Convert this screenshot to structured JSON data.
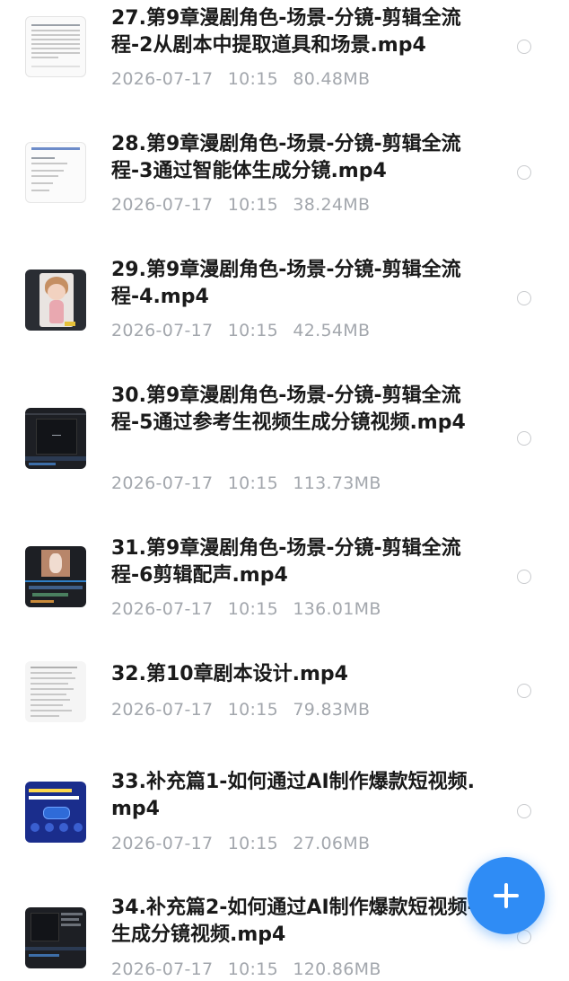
{
  "files": [
    {
      "name": "27.第9章漫剧角色-场景-分镜-剪辑全流程-2从剧本中提取道具和场景.mp4",
      "date": "2026-07-17",
      "time": "10:15",
      "size": "80.48MB",
      "thumb": "document"
    },
    {
      "name": "28.第9章漫剧角色-场景-分镜-剪辑全流程-3通过智能体生成分镜.mp4",
      "date": "2026-07-17",
      "time": "10:15",
      "size": "38.24MB",
      "thumb": "document"
    },
    {
      "name": "29.第9章漫剧角色-场景-分镜-剪辑全流程-4.mp4",
      "date": "2026-07-17",
      "time": "10:15",
      "size": "42.54MB",
      "thumb": "character"
    },
    {
      "name": "30.第9章漫剧角色-场景-分镜-剪辑全流程-5通过参考生视频生成分镜视频.mp4",
      "date": "2026-07-17",
      "time": "10:15",
      "size": "113.73MB",
      "thumb": "dark-editor"
    },
    {
      "name": "31.第9章漫剧角色-场景-分镜-剪辑全流程-6剪辑配声.mp4",
      "date": "2026-07-17",
      "time": "10:15",
      "size": "136.01MB",
      "thumb": "video-editor"
    },
    {
      "name": "32.第10章剧本设计.mp4",
      "date": "2026-07-17",
      "time": "10:15",
      "size": "79.83MB",
      "thumb": "text-list"
    },
    {
      "name": "33.补充篇1-如何通过AI制作爆款短视频.mp4",
      "date": "2026-07-17",
      "time": "10:15",
      "size": "27.06MB",
      "thumb": "blue-slide"
    },
    {
      "name": "34.补充篇2-如何通过AI制作爆款短视频-生成分镜视频.mp4",
      "date": "2026-07-17",
      "time": "10:15",
      "size": "120.86MB",
      "thumb": "dark-editor"
    }
  ],
  "fab": {
    "icon": "plus-icon",
    "color": "#2f8cf5"
  }
}
